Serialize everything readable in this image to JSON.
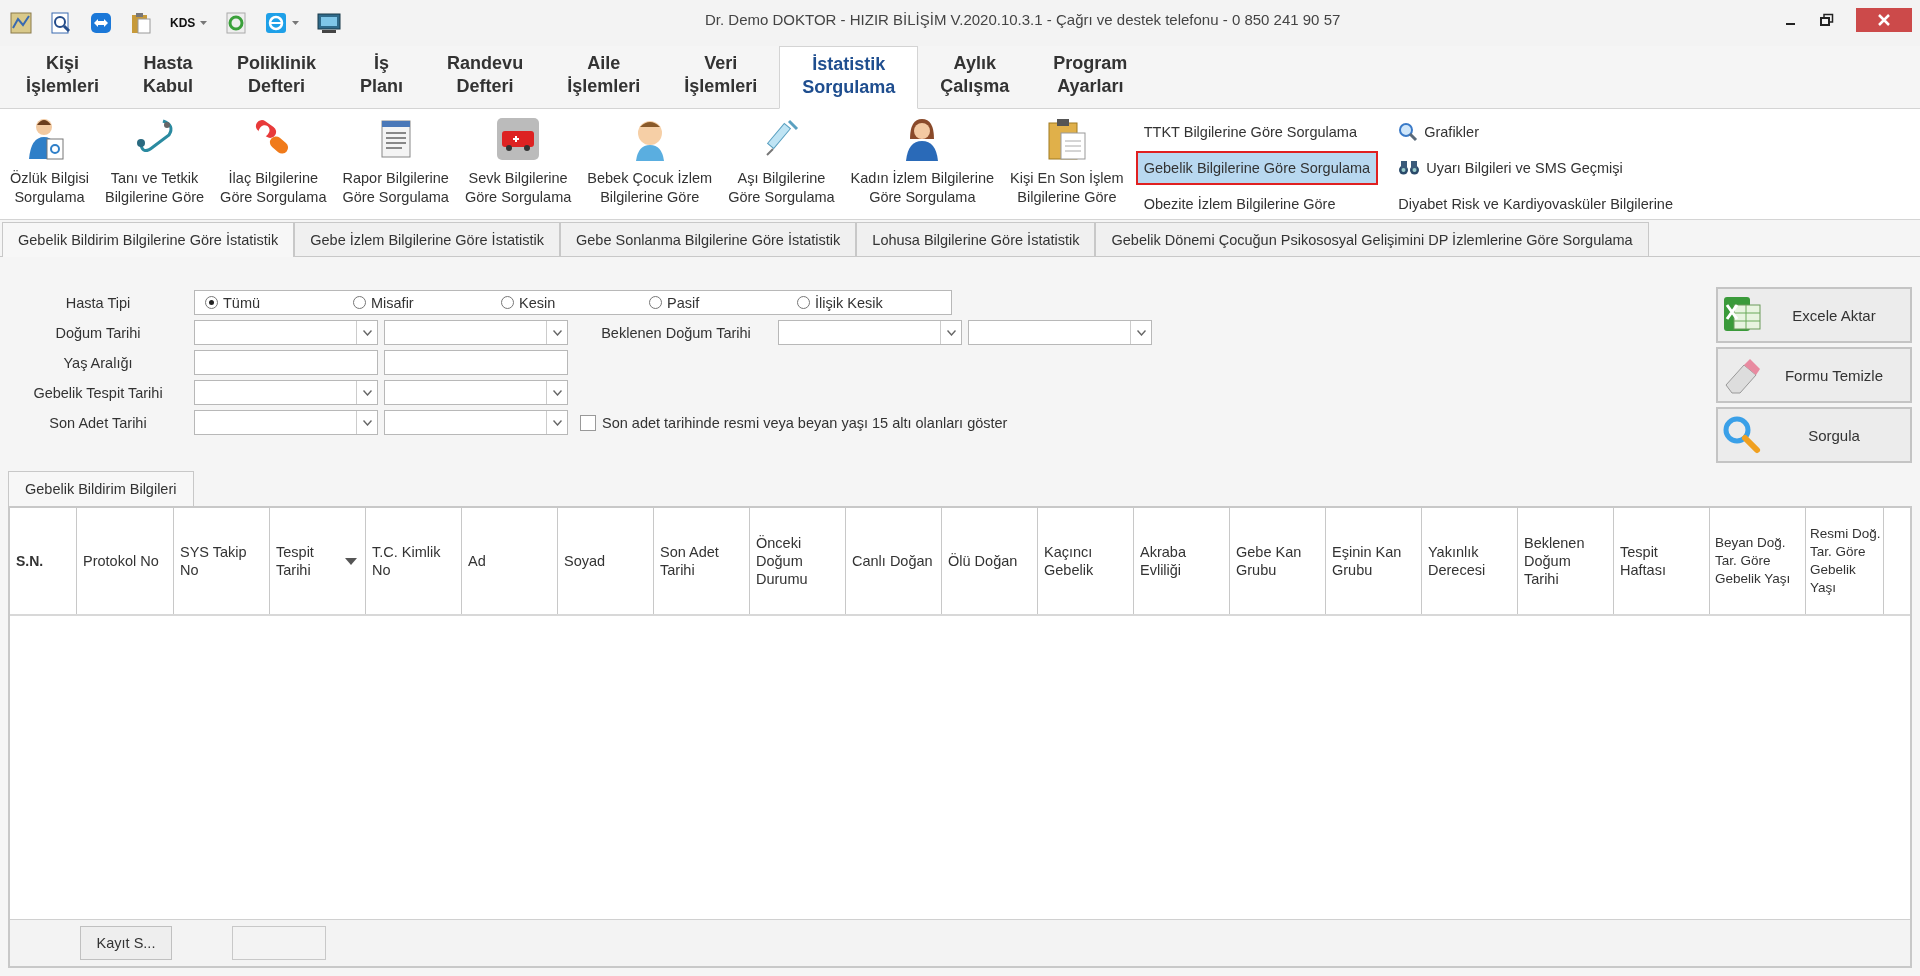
{
  "window": {
    "title": "Dr. Demo DOKTOR - HIZIR BİLİŞİM V.2020.10.3.1 - Çağrı ve destek telefonu - 0 850 241 90 57"
  },
  "quick_toolbar": [
    {
      "kind": "map",
      "dropdown": false
    },
    {
      "kind": "preview",
      "dropdown": false
    },
    {
      "kind": "remote",
      "dropdown": false
    },
    {
      "kind": "clipboard",
      "dropdown": false
    },
    {
      "kind": "text",
      "label": "KDS",
      "dropdown": true
    },
    {
      "kind": "refresh",
      "dropdown": false
    },
    {
      "kind": "browser",
      "dropdown": true
    },
    {
      "kind": "monitor",
      "dropdown": false
    }
  ],
  "menu_tabs": [
    {
      "lines": [
        "Kişi",
        "İşlemleri"
      ],
      "selected": false
    },
    {
      "lines": [
        "Hasta",
        "Kabul"
      ],
      "selected": false
    },
    {
      "lines": [
        "Poliklinik",
        "Defteri"
      ],
      "selected": false
    },
    {
      "lines": [
        "İş",
        "Planı"
      ],
      "selected": false
    },
    {
      "lines": [
        "Randevu",
        "Defteri"
      ],
      "selected": false
    },
    {
      "lines": [
        "Aile",
        "İşlemleri"
      ],
      "selected": false
    },
    {
      "lines": [
        "Veri",
        "İşlemleri"
      ],
      "selected": false
    },
    {
      "lines": [
        "İstatistik",
        "Sorgulama"
      ],
      "selected": true
    },
    {
      "lines": [
        "Aylık",
        "Çalışma"
      ],
      "selected": false
    },
    {
      "lines": [
        "Program",
        "Ayarları"
      ],
      "selected": false
    }
  ],
  "ribbon_buttons": [
    {
      "kind": "person-doc",
      "lines": [
        "Özlük Bilgisi",
        "Sorgulama"
      ]
    },
    {
      "kind": "stethoscope",
      "lines": [
        "Tanı ve Tetkik",
        "Bilgilerine Göre"
      ]
    },
    {
      "kind": "pills",
      "lines": [
        "İlaç Bilgilerine",
        "Göre Sorgulama"
      ]
    },
    {
      "kind": "report",
      "lines": [
        "Rapor Bilgilerine",
        "Göre Sorgulama"
      ]
    },
    {
      "kind": "ambulance",
      "lines": [
        "Sevk Bilgilerine",
        "Göre Sorgulama"
      ]
    },
    {
      "kind": "baby",
      "lines": [
        "Bebek Çocuk İzlem",
        "Bilgilerine Göre"
      ]
    },
    {
      "kind": "syringe",
      "lines": [
        "Aşı Bilgilerine",
        "Göre Sorgulama"
      ]
    },
    {
      "kind": "woman",
      "lines": [
        "Kadın İzlem Bilgilerine",
        "Göre Sorgulama"
      ]
    },
    {
      "kind": "clipboard",
      "lines": [
        "Kişi En Son İşlem",
        "Bilgilerine Göre"
      ]
    }
  ],
  "ribbon_links": [
    [
      {
        "kind": "plain",
        "label": "TTKT Bilgilerine Göre Sorgulama",
        "selected": false
      },
      {
        "kind": "plain",
        "label": "Gebelik Bilgilerine Göre Sorgulama",
        "selected": true
      },
      {
        "kind": "plain",
        "label": "Obezite İzlem Bilgilerine Göre",
        "selected": false
      }
    ],
    [
      {
        "kind": "magnifier",
        "label": "Grafikler",
        "selected": false
      },
      {
        "kind": "binoculars",
        "label": "Uyarı Bilgileri ve SMS Geçmişi",
        "selected": false
      },
      {
        "kind": "plain",
        "label": "Diyabet Risk ve Kardiyovasküler Bilgilerine",
        "selected": false
      }
    ]
  ],
  "sub_tabs": [
    {
      "label": "Gebelik Bildirim Bilgilerine Göre İstatistik",
      "selected": true
    },
    {
      "label": "Gebe İzlem Bilgilerine Göre İstatistik",
      "selected": false
    },
    {
      "label": "Gebe Sonlanma Bilgilerine Göre İstatistik",
      "selected": false
    },
    {
      "label": "Lohusa Bilgilerine Göre İstatistik",
      "selected": false
    },
    {
      "label": "Gebelik Dönemi Çocuğun Psikososyal Gelişimini DP İzlemlerine Göre Sorgulama",
      "selected": false
    }
  ],
  "form": {
    "patient_type": {
      "label": "Hasta Tipi",
      "options": [
        {
          "label": "Tümü",
          "selected": true
        },
        {
          "label": "Misafir",
          "selected": false
        },
        {
          "label": "Kesin",
          "selected": false
        },
        {
          "label": "Pasif",
          "selected": false
        },
        {
          "label": "İlişik Kesik",
          "selected": false
        }
      ]
    },
    "birth_date": {
      "label": "Doğum Tarihi"
    },
    "expected_birth_date": {
      "label": "Beklenen Doğum Tarihi"
    },
    "age_range": {
      "label": "Yaş Aralığı"
    },
    "detection_date": {
      "label": "Gebelik Tespit Tarihi"
    },
    "last_period_date": {
      "label": "Son Adet Tarihi"
    },
    "under_15": {
      "label": "Son adet tarihinde resmi veya beyan yaşı 15 altı olanları göster",
      "checked": false
    }
  },
  "actions": [
    {
      "kind": "excel",
      "label": "Excele Aktar"
    },
    {
      "kind": "eraser",
      "label": "Formu Temizle"
    },
    {
      "kind": "search",
      "label": "Sorgula"
    }
  ],
  "grid": {
    "tab": "Gebelik Bildirim Bilgileri",
    "columns": [
      {
        "label": "S.N.",
        "sorted": false
      },
      {
        "label": "Protokol No",
        "sorted": false
      },
      {
        "label": "SYS Takip No",
        "sorted": false
      },
      {
        "label": "Tespit Tarihi",
        "sorted": true
      },
      {
        "label": "T.C. Kimlik No",
        "sorted": false
      },
      {
        "label": "Ad",
        "sorted": false
      },
      {
        "label": "Soyad",
        "sorted": false
      },
      {
        "label": "Son Adet Tarihi",
        "sorted": false
      },
      {
        "label": "Önceki Doğum Durumu",
        "sorted": false
      },
      {
        "label": "Canlı Doğan",
        "sorted": false
      },
      {
        "label": "Ölü Doğan",
        "sorted": false
      },
      {
        "label": "Kaçıncı Gebelik",
        "sorted": false
      },
      {
        "label": "Akraba Evliliği",
        "sorted": false
      },
      {
        "label": "Gebe Kan Grubu",
        "sorted": false
      },
      {
        "label": "Eşinin Kan Grubu",
        "sorted": false
      },
      {
        "label": "Yakınlık Derecesi",
        "sorted": false
      },
      {
        "label": "Beklenen Doğum Tarihi",
        "sorted": false
      },
      {
        "label": "Tespit Haftası",
        "sorted": false
      },
      {
        "label": "Beyan Doğ. Tar. Göre Gebelik Yaşı",
        "sorted": false
      },
      {
        "label": "Resmi Doğ. Tar. Göre Gebelik Yaşı",
        "sorted": false
      }
    ],
    "footer_button": "Kayıt S..."
  }
}
